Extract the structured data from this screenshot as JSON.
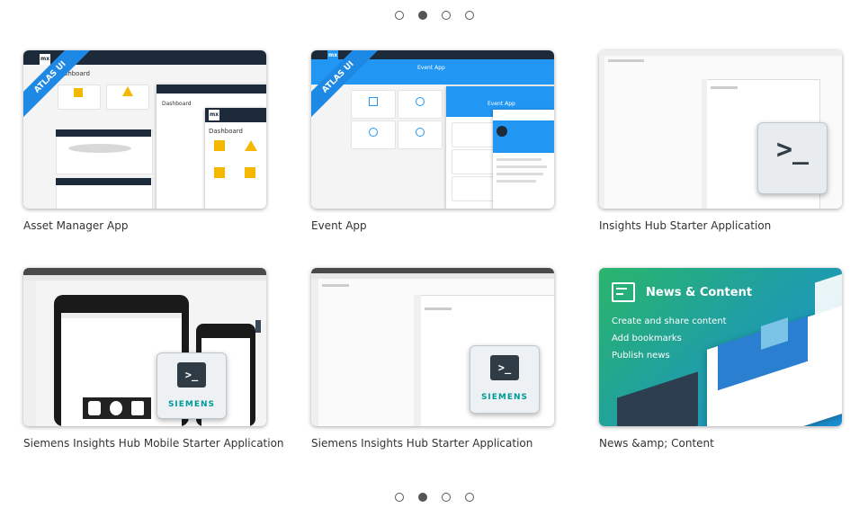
{
  "pager": {
    "pages": [
      "1",
      "2",
      "3",
      "4"
    ],
    "active_index": 1
  },
  "cards": [
    {
      "title": "Asset Manager App",
      "thumb": {
        "ribbon": "ATLAS UI",
        "heading": "Dashboard",
        "logo": "mx"
      }
    },
    {
      "title": "Event App",
      "thumb": {
        "ribbon": "ATLAS UI",
        "heading": "Event App",
        "logo": "mx"
      }
    },
    {
      "title": "Insights Hub Starter Application",
      "thumb": {
        "prompt": ">_"
      }
    },
    {
      "title": "Siemens Insights Hub Mobile Starter Application",
      "thumb": {
        "prompt": ">_",
        "brand": "SIEMENS"
      }
    },
    {
      "title": "Siemens Insights Hub Starter Application",
      "thumb": {
        "prompt": ">_",
        "brand": "SIEMENS"
      }
    },
    {
      "title": "News &amp; Content",
      "thumb": {
        "heading": "News & Content",
        "bullets": [
          "Create and share content",
          "Add bookmarks",
          "Publish news"
        ]
      }
    }
  ],
  "colors": {
    "accent": "#1e88e5",
    "siemens": "#009999",
    "news_start": "#2ab56b",
    "news_end": "#1a8fd6"
  }
}
